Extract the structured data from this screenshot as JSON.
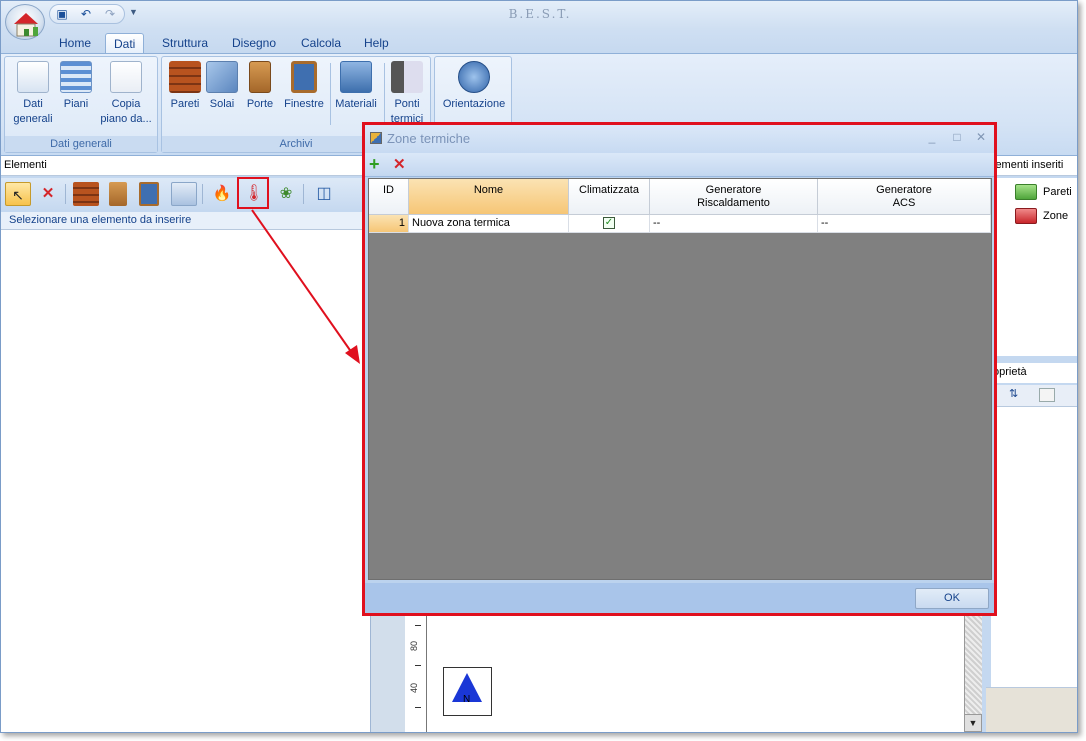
{
  "app": {
    "title": "B.E.S.T."
  },
  "tabs": [
    "Home",
    "Dati",
    "Struttura",
    "Disegno",
    "Calcola",
    "Help"
  ],
  "active_tab": "Dati",
  "ribbon": {
    "dati_generali": {
      "label": "Dati generali",
      "buttons": [
        {
          "label": "Dati\ngenerali",
          "icon": "pencil-document-icon"
        },
        {
          "label": "Piani",
          "icon": "layers-icon"
        },
        {
          "label": "Copia\npiano da...",
          "icon": "copy-document-icon"
        }
      ]
    },
    "archivi": {
      "label": "Archivi",
      "buttons": [
        {
          "label": "Pareti",
          "icon": "brick-wall-icon"
        },
        {
          "label": "Solai",
          "icon": "floor-slab-icon"
        },
        {
          "label": "Porte",
          "icon": "door-icon"
        },
        {
          "label": "Finestre",
          "icon": "window-icon"
        },
        {
          "label": "Materiali",
          "icon": "materials-icon"
        },
        {
          "label": "Ponti\ntermici",
          "icon": "thermal-bridge-icon"
        }
      ]
    },
    "orientazione": {
      "label": "Orientazione",
      "icon": "compass-icon"
    }
  },
  "left_panel": {
    "header": "Elementi",
    "hint": "Selezionare una elemento da inserire"
  },
  "right_panel": {
    "header": "lementi inseriti",
    "items": [
      "Pareti",
      "Zone"
    ],
    "properties_header": "oprietà"
  },
  "dialog": {
    "title": "Zone termiche",
    "columns": [
      "ID",
      "Nome",
      "Climatizzata",
      "Generatore\nRiscaldamento",
      "Generatore\nACS"
    ],
    "rows": [
      {
        "id": "1",
        "nome": "Nuova zona termica",
        "climatizzata": true,
        "riscaldamento": "--",
        "acs": "--"
      }
    ],
    "ok_label": "OK"
  },
  "drawing": {
    "ruler_labels": [
      "80",
      "40"
    ],
    "north_label": "N"
  },
  "colors": {
    "annotation": "#e0101e",
    "accent": "#15428b",
    "selected_header": "#f6c676",
    "grid_empty": "#808080"
  }
}
